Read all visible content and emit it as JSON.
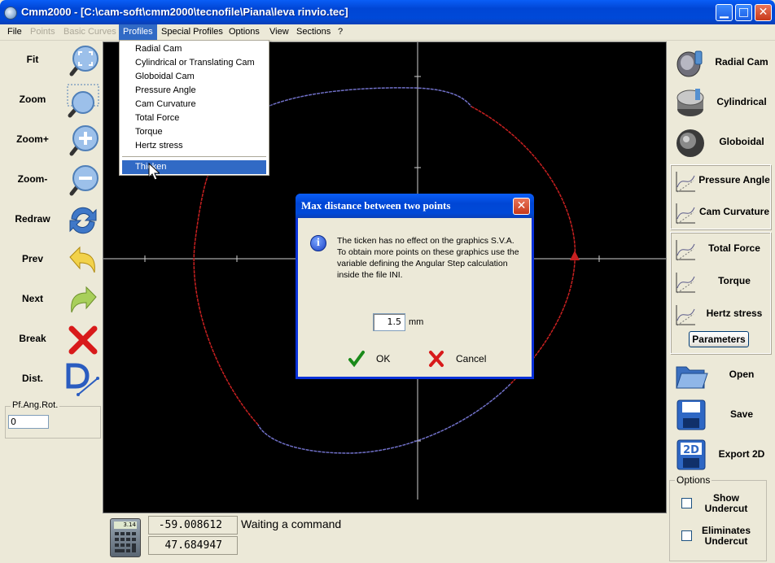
{
  "window": {
    "title": "Cmm2000 - [C:\\cam-soft\\cmm2000\\tecnofile\\Piana\\leva rinvio.tec]"
  },
  "menubar": {
    "items": [
      "File",
      "Points",
      "Basic Curves",
      "Profiles",
      "Special Profiles",
      "Options",
      "View",
      "Sections",
      "?"
    ]
  },
  "profiles_menu": {
    "items": [
      "Radial Cam",
      "Cylindrical or Translating Cam",
      "Globoidal Cam",
      "Pressure Angle",
      "Cam Curvature",
      "Total Force",
      "Torque",
      "Hertz stress"
    ],
    "highlighted": "Thicken"
  },
  "left_toolbar": {
    "items": [
      "Fit",
      "Zoom",
      "Zoom+",
      "Zoom-",
      "Redraw",
      "Prev",
      "Next",
      "Break",
      "Dist."
    ],
    "pf_label": "Pf.Ang.Rot.",
    "pf_value": "0"
  },
  "status": {
    "coord_x": "-59.008612",
    "coord_y": "47.684947",
    "message": "Waiting a command",
    "calc_screen": "3.14"
  },
  "right_panel": {
    "cam_types": [
      "Radial Cam",
      "Cylindrical",
      "Globoidal"
    ],
    "analysis": [
      "Pressure Angle",
      "Cam Curvature"
    ],
    "forces": [
      "Total Force",
      "Torque",
      "Hertz stress"
    ],
    "parameters": "Parameters",
    "file_ops": [
      "Open",
      "Save",
      "Export 2D"
    ],
    "options_label": "Options",
    "show_undercut": "Show Undercut",
    "eliminates_undercut": "Eliminates Undercut"
  },
  "dialog": {
    "title": "Max distance between two points",
    "message_lines": [
      "The ticken has no effect on the graphics S.V.A.",
      "To obtain more points on these graphics use the",
      "variable defining the Angular Step calculation",
      "inside the file INI."
    ],
    "value": "1.5",
    "unit": "mm",
    "ok": "OK",
    "cancel": "Cancel"
  },
  "colors": {
    "titlebar": "#0054e3",
    "menu_highlight": "#316ac5",
    "profile_blue": "#7070c8",
    "profile_red": "#c82020",
    "canvas": "#000000"
  },
  "icons": {
    "calculator": "calculator-icon",
    "info": "info-icon",
    "ok": "green-check-icon",
    "cancel": "red-x-icon"
  }
}
